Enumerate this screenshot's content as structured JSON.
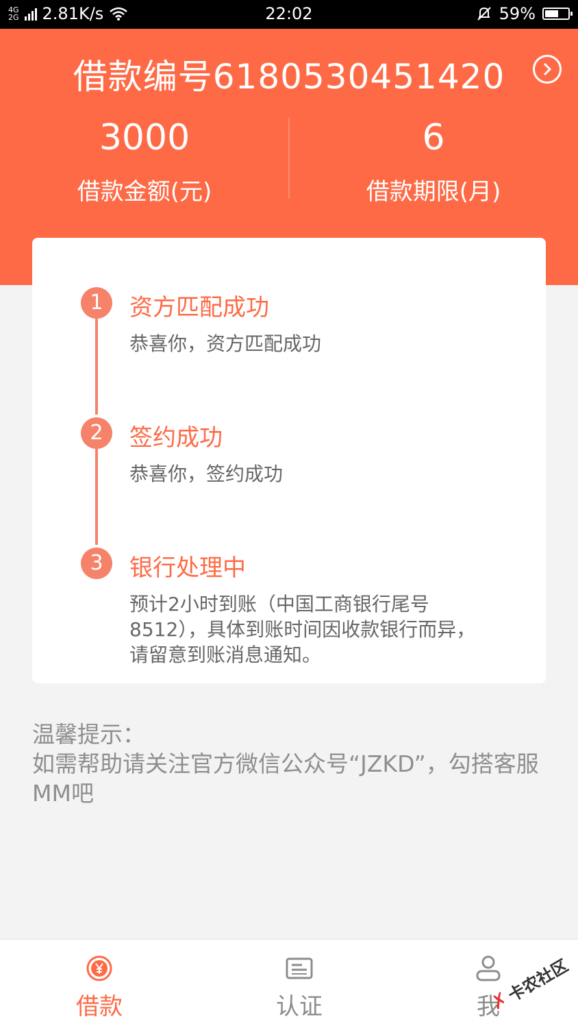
{
  "status_bar": {
    "network_top": "4G",
    "network_bottom": "2G",
    "speed": "2.81K/s",
    "time": "22:02",
    "battery": "59%",
    "battery_level": 0.59
  },
  "header": {
    "loan_number": "借款编号6180530451420",
    "amount_value": "3000",
    "amount_label": "借款金额(元)",
    "term_value": "6",
    "term_label": "借款期限(月)"
  },
  "steps": [
    {
      "num": "1",
      "title": "资方匹配成功",
      "desc": "恭喜你，资方匹配成功"
    },
    {
      "num": "2",
      "title": "签约成功",
      "desc": "恭喜你，签约成功"
    },
    {
      "num": "3",
      "title": "银行处理中",
      "desc": "预计2小时到账（中国工商银行尾号8512），具体到账时间因收款银行而异，请留意到账消息通知。"
    }
  ],
  "tips": {
    "title": "温馨提示：",
    "text": "如需帮助请关注官方微信公众号“JZKD”，勾搭客服MM吧"
  },
  "nav": {
    "items": [
      {
        "label": "借款",
        "icon": "yen-circle-icon",
        "active": true
      },
      {
        "label": "认证",
        "icon": "id-card-icon",
        "active": false
      },
      {
        "label": "我",
        "icon": "person-icon",
        "active": false
      }
    ]
  },
  "watermark": "卡农社区",
  "colors": {
    "accent": "#fe6a46",
    "timeline": "#f7826a",
    "background": "#f3f3f3"
  }
}
